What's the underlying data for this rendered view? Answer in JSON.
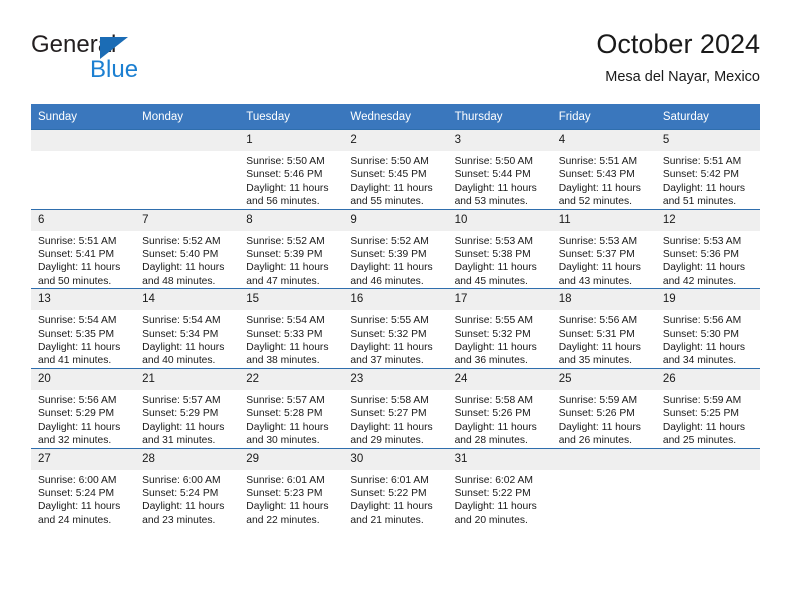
{
  "brand": {
    "name_top": "General",
    "name_bottom": "Blue",
    "accent_color": "#1b7fd1",
    "triangle_color": "#1b6cb5"
  },
  "header": {
    "title": "October 2024",
    "subtitle": "Mesa del Nayar, Mexico"
  },
  "calendar": {
    "header_bg": "#3a77bd",
    "daynum_bg": "#efefef",
    "row_border_color": "#2f6ead",
    "weekdays": [
      "Sunday",
      "Monday",
      "Tuesday",
      "Wednesday",
      "Thursday",
      "Friday",
      "Saturday"
    ],
    "weeks": [
      [
        {
          "day": "",
          "empty": true
        },
        {
          "day": "",
          "empty": true
        },
        {
          "day": "1",
          "sunrise": "Sunrise: 5:50 AM",
          "sunset": "Sunset: 5:46 PM",
          "daylight": "Daylight: 11 hours and 56 minutes."
        },
        {
          "day": "2",
          "sunrise": "Sunrise: 5:50 AM",
          "sunset": "Sunset: 5:45 PM",
          "daylight": "Daylight: 11 hours and 55 minutes."
        },
        {
          "day": "3",
          "sunrise": "Sunrise: 5:50 AM",
          "sunset": "Sunset: 5:44 PM",
          "daylight": "Daylight: 11 hours and 53 minutes."
        },
        {
          "day": "4",
          "sunrise": "Sunrise: 5:51 AM",
          "sunset": "Sunset: 5:43 PM",
          "daylight": "Daylight: 11 hours and 52 minutes."
        },
        {
          "day": "5",
          "sunrise": "Sunrise: 5:51 AM",
          "sunset": "Sunset: 5:42 PM",
          "daylight": "Daylight: 11 hours and 51 minutes."
        }
      ],
      [
        {
          "day": "6",
          "sunrise": "Sunrise: 5:51 AM",
          "sunset": "Sunset: 5:41 PM",
          "daylight": "Daylight: 11 hours and 50 minutes."
        },
        {
          "day": "7",
          "sunrise": "Sunrise: 5:52 AM",
          "sunset": "Sunset: 5:40 PM",
          "daylight": "Daylight: 11 hours and 48 minutes."
        },
        {
          "day": "8",
          "sunrise": "Sunrise: 5:52 AM",
          "sunset": "Sunset: 5:39 PM",
          "daylight": "Daylight: 11 hours and 47 minutes."
        },
        {
          "day": "9",
          "sunrise": "Sunrise: 5:52 AM",
          "sunset": "Sunset: 5:39 PM",
          "daylight": "Daylight: 11 hours and 46 minutes."
        },
        {
          "day": "10",
          "sunrise": "Sunrise: 5:53 AM",
          "sunset": "Sunset: 5:38 PM",
          "daylight": "Daylight: 11 hours and 45 minutes."
        },
        {
          "day": "11",
          "sunrise": "Sunrise: 5:53 AM",
          "sunset": "Sunset: 5:37 PM",
          "daylight": "Daylight: 11 hours and 43 minutes."
        },
        {
          "day": "12",
          "sunrise": "Sunrise: 5:53 AM",
          "sunset": "Sunset: 5:36 PM",
          "daylight": "Daylight: 11 hours and 42 minutes."
        }
      ],
      [
        {
          "day": "13",
          "sunrise": "Sunrise: 5:54 AM",
          "sunset": "Sunset: 5:35 PM",
          "daylight": "Daylight: 11 hours and 41 minutes."
        },
        {
          "day": "14",
          "sunrise": "Sunrise: 5:54 AM",
          "sunset": "Sunset: 5:34 PM",
          "daylight": "Daylight: 11 hours and 40 minutes."
        },
        {
          "day": "15",
          "sunrise": "Sunrise: 5:54 AM",
          "sunset": "Sunset: 5:33 PM",
          "daylight": "Daylight: 11 hours and 38 minutes."
        },
        {
          "day": "16",
          "sunrise": "Sunrise: 5:55 AM",
          "sunset": "Sunset: 5:32 PM",
          "daylight": "Daylight: 11 hours and 37 minutes."
        },
        {
          "day": "17",
          "sunrise": "Sunrise: 5:55 AM",
          "sunset": "Sunset: 5:32 PM",
          "daylight": "Daylight: 11 hours and 36 minutes."
        },
        {
          "day": "18",
          "sunrise": "Sunrise: 5:56 AM",
          "sunset": "Sunset: 5:31 PM",
          "daylight": "Daylight: 11 hours and 35 minutes."
        },
        {
          "day": "19",
          "sunrise": "Sunrise: 5:56 AM",
          "sunset": "Sunset: 5:30 PM",
          "daylight": "Daylight: 11 hours and 34 minutes."
        }
      ],
      [
        {
          "day": "20",
          "sunrise": "Sunrise: 5:56 AM",
          "sunset": "Sunset: 5:29 PM",
          "daylight": "Daylight: 11 hours and 32 minutes."
        },
        {
          "day": "21",
          "sunrise": "Sunrise: 5:57 AM",
          "sunset": "Sunset: 5:29 PM",
          "daylight": "Daylight: 11 hours and 31 minutes."
        },
        {
          "day": "22",
          "sunrise": "Sunrise: 5:57 AM",
          "sunset": "Sunset: 5:28 PM",
          "daylight": "Daylight: 11 hours and 30 minutes."
        },
        {
          "day": "23",
          "sunrise": "Sunrise: 5:58 AM",
          "sunset": "Sunset: 5:27 PM",
          "daylight": "Daylight: 11 hours and 29 minutes."
        },
        {
          "day": "24",
          "sunrise": "Sunrise: 5:58 AM",
          "sunset": "Sunset: 5:26 PM",
          "daylight": "Daylight: 11 hours and 28 minutes."
        },
        {
          "day": "25",
          "sunrise": "Sunrise: 5:59 AM",
          "sunset": "Sunset: 5:26 PM",
          "daylight": "Daylight: 11 hours and 26 minutes."
        },
        {
          "day": "26",
          "sunrise": "Sunrise: 5:59 AM",
          "sunset": "Sunset: 5:25 PM",
          "daylight": "Daylight: 11 hours and 25 minutes."
        }
      ],
      [
        {
          "day": "27",
          "sunrise": "Sunrise: 6:00 AM",
          "sunset": "Sunset: 5:24 PM",
          "daylight": "Daylight: 11 hours and 24 minutes."
        },
        {
          "day": "28",
          "sunrise": "Sunrise: 6:00 AM",
          "sunset": "Sunset: 5:24 PM",
          "daylight": "Daylight: 11 hours and 23 minutes."
        },
        {
          "day": "29",
          "sunrise": "Sunrise: 6:01 AM",
          "sunset": "Sunset: 5:23 PM",
          "daylight": "Daylight: 11 hours and 22 minutes."
        },
        {
          "day": "30",
          "sunrise": "Sunrise: 6:01 AM",
          "sunset": "Sunset: 5:22 PM",
          "daylight": "Daylight: 11 hours and 21 minutes."
        },
        {
          "day": "31",
          "sunrise": "Sunrise: 6:02 AM",
          "sunset": "Sunset: 5:22 PM",
          "daylight": "Daylight: 11 hours and 20 minutes."
        },
        {
          "day": "",
          "empty": true
        },
        {
          "day": "",
          "empty": true
        }
      ]
    ]
  }
}
